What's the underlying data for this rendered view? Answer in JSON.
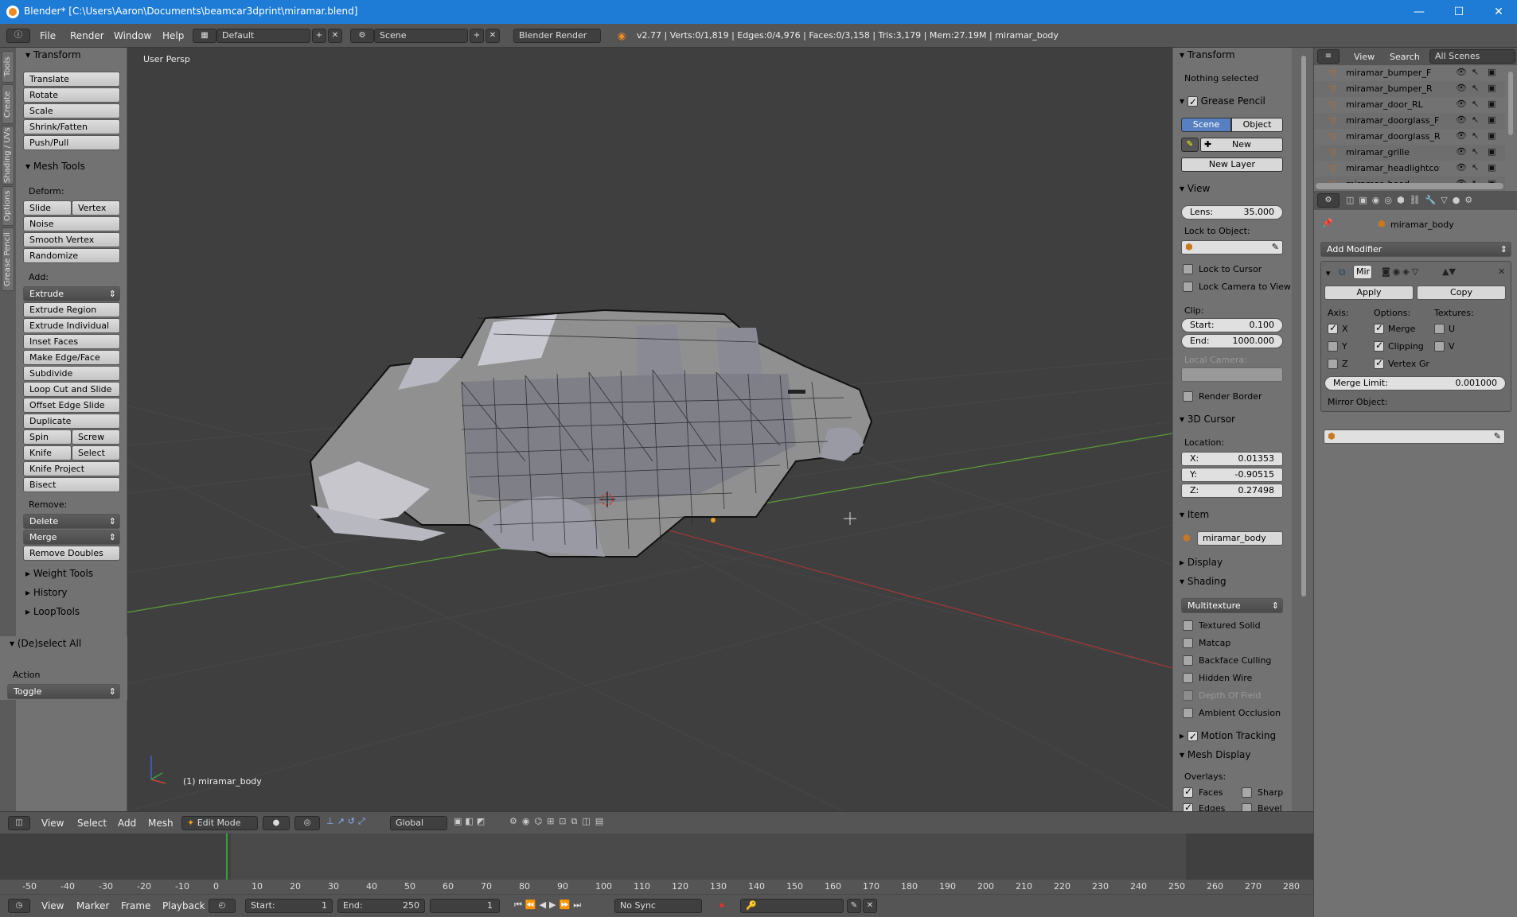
{
  "window": {
    "title": "Blender* [C:\\Users\\Aaron\\Documents\\beamcar3dprint\\miramar.blend]",
    "min": "—",
    "max": "☐",
    "close": "✕"
  },
  "topbar": {
    "menus": [
      "File",
      "Render",
      "Window",
      "Help"
    ],
    "layout": "Default",
    "scene": "Scene",
    "engine": "Blender Render",
    "stats": "v2.77 | Verts:0/1,819 | Edges:0/4,976 | Faces:0/3,158 | Tris:3,179 | Mem:27.19M | miramar_body"
  },
  "left_tabs": [
    "Tools",
    "Create",
    "Shading / UVs",
    "Options",
    "Grease Pencil"
  ],
  "toolshelf": {
    "transform_header": "Transform",
    "transform": [
      "Translate",
      "Rotate",
      "Scale",
      "Shrink/Fatten",
      "Push/Pull"
    ],
    "mesh_tools_header": "Mesh Tools",
    "deform_label": "Deform:",
    "slide_edge": "Slide Edge",
    "vertex": "Vertex",
    "noise": "Noise",
    "smooth_vertex": "Smooth Vertex",
    "randomize": "Randomize",
    "add_label": "Add:",
    "extrude": "Extrude",
    "extrude_region": "Extrude Region",
    "extrude_individual": "Extrude Individual",
    "inset_faces": "Inset Faces",
    "make_edge_face": "Make Edge/Face",
    "subdivide": "Subdivide",
    "loop_cut": "Loop Cut and Slide",
    "offset_edge": "Offset Edge Slide",
    "duplicate": "Duplicate",
    "spin": "Spin",
    "screw": "Screw",
    "knife": "Knife",
    "select": "Select",
    "knife_project": "Knife Project",
    "bisect": "Bisect",
    "remove_label": "Remove:",
    "delete": "Delete",
    "merge": "Merge",
    "remove_doubles": "Remove Doubles",
    "weight_tools": "Weight Tools",
    "history": "History",
    "looptools": "LoopTools",
    "deselect_all": "(De)select All",
    "action_label": "Action",
    "action_value": "Toggle"
  },
  "viewport": {
    "view_label": "User Persp",
    "object_label": "(1) miramar_body"
  },
  "npanel": {
    "transform": "Transform",
    "nothing_selected": "Nothing selected",
    "grease_pencil": "Grease Pencil",
    "scene_btn": "Scene",
    "object_btn": "Object",
    "new_btn": "New",
    "new_layer": "New Layer",
    "view": "View",
    "lens_label": "Lens:",
    "lens_value": "35.000",
    "lock_to_object": "Lock to Object:",
    "lock_to_cursor": "Lock to Cursor",
    "lock_camera": "Lock Camera to View",
    "clip": "Clip:",
    "clip_start_label": "Start:",
    "clip_start": "0.100",
    "clip_end_label": "End:",
    "clip_end": "1000.000",
    "local_camera": "Local Camera:",
    "render_border": "Render Border",
    "cursor_header": "3D Cursor",
    "location": "Location:",
    "x_label": "X:",
    "x": "0.01353",
    "y_label": "Y:",
    "y": "-0.90515",
    "z_label": "Z:",
    "z": "0.27498",
    "item": "Item",
    "item_name": "miramar_body",
    "display": "Display",
    "shading": "Shading",
    "shading_mode": "Multitexture",
    "textured_solid": "Textured Solid",
    "matcap": "Matcap",
    "backface": "Backface Culling",
    "hidden_wire": "Hidden Wire",
    "dof": "Depth Of Field",
    "ao": "Ambient Occlusion",
    "motion_tracking": "Motion Tracking",
    "mesh_display": "Mesh Display",
    "overlays": "Overlays:",
    "faces": "Faces",
    "sharp": "Sharp",
    "edges": "Edges",
    "bevel": "Bevel"
  },
  "outliner": {
    "view": "View",
    "search": "Search",
    "scenes": "All Scenes",
    "items": [
      "miramar_bumper_F",
      "miramar_bumper_R",
      "miramar_door_RL",
      "miramar_doorglass_FL",
      "miramar_doorglass_RL",
      "miramar_grille",
      "miramar_headlightcove",
      "miramar_hood"
    ]
  },
  "properties": {
    "object": "miramar_body",
    "add_modifier": "Add Modifier",
    "mod_name": "Mir",
    "apply": "Apply",
    "copy": "Copy",
    "axis": "Axis:",
    "options": "Options:",
    "textures": "Textures:",
    "x": "X",
    "y": "Y",
    "z": "Z",
    "merge": "Merge",
    "clipping": "Clipping",
    "vertex_gr": "Vertex Gr",
    "u": "U",
    "v": "V",
    "merge_limit_label": "Merge Limit:",
    "merge_limit": "0.001000",
    "mirror_object": "Mirror Object:"
  },
  "vp_toolbar": {
    "menus": [
      "View",
      "Select",
      "Add",
      "Mesh"
    ],
    "mode": "Edit Mode",
    "orientation": "Global"
  },
  "timeline": {
    "ticks": [
      "-50",
      "-40",
      "-30",
      "-20",
      "-10",
      "0",
      "10",
      "20",
      "30",
      "40",
      "50",
      "60",
      "70",
      "80",
      "90",
      "100",
      "110",
      "120",
      "130",
      "140",
      "150",
      "160",
      "170",
      "180",
      "190",
      "200",
      "210",
      "220",
      "230",
      "240",
      "250",
      "260",
      "270",
      "280"
    ],
    "menus": [
      "View",
      "Marker",
      "Frame",
      "Playback"
    ],
    "start_label": "Start:",
    "start": "1",
    "end_label": "End:",
    "end": "250",
    "current": "1",
    "sync": "No Sync"
  }
}
